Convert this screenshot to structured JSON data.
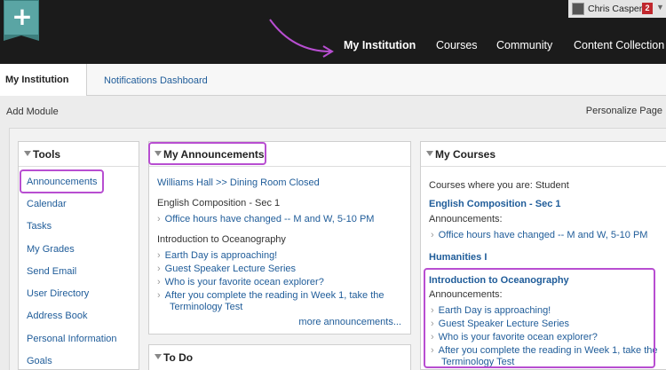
{
  "header": {
    "user_name": "Chris Casper",
    "notification_count": "2",
    "nav": [
      "My Institution",
      "Courses",
      "Community",
      "Content Collection"
    ]
  },
  "tabs": {
    "active": "My Institution",
    "second": "Notifications Dashboard"
  },
  "actions": {
    "add_module": "Add Module",
    "personalize": "Personalize Page"
  },
  "tools": {
    "title": "Tools",
    "items": [
      "Announcements",
      "Calendar",
      "Tasks",
      "My Grades",
      "Send Email",
      "User Directory",
      "Address Book",
      "Personal Information",
      "Goals"
    ]
  },
  "announcements": {
    "title": "My Announcements",
    "top_link": "Williams Hall >> Dining Room Closed",
    "course1": "English Composition - Sec 1",
    "course1_items": [
      "Office hours have changed -- M and W, 5-10 PM"
    ],
    "course2": "Introduction to Oceanography",
    "course2_items": [
      "Earth Day is approaching!",
      "Guest Speaker Lecture Series",
      "Who is your favorite ocean explorer?",
      "After you complete the reading in Week 1, take the",
      "Terminology Test"
    ],
    "more": "more announcements..."
  },
  "todo": {
    "title": "To Do"
  },
  "courses": {
    "title": "My Courses",
    "subtitle": "Courses where you are: Student",
    "list": [
      {
        "name": "English Composition - Sec 1",
        "label": "Announcements:",
        "items": [
          "Office hours have changed -- M and W, 5-10 PM"
        ]
      },
      {
        "name": "Humanities I"
      },
      {
        "name": "Introduction to Oceanography",
        "label": "Announcements:",
        "items": [
          "Earth Day is approaching!",
          "Guest Speaker Lecture Series",
          "Who is your favorite ocean explorer?",
          "After you complete the reading in Week 1, take the",
          "Terminology Test"
        ]
      }
    ]
  },
  "colors": {
    "highlight": "#b84ed1",
    "link": "#1f5c99",
    "topbar": "#1b1b1b",
    "logo": "#5aa5a4"
  }
}
